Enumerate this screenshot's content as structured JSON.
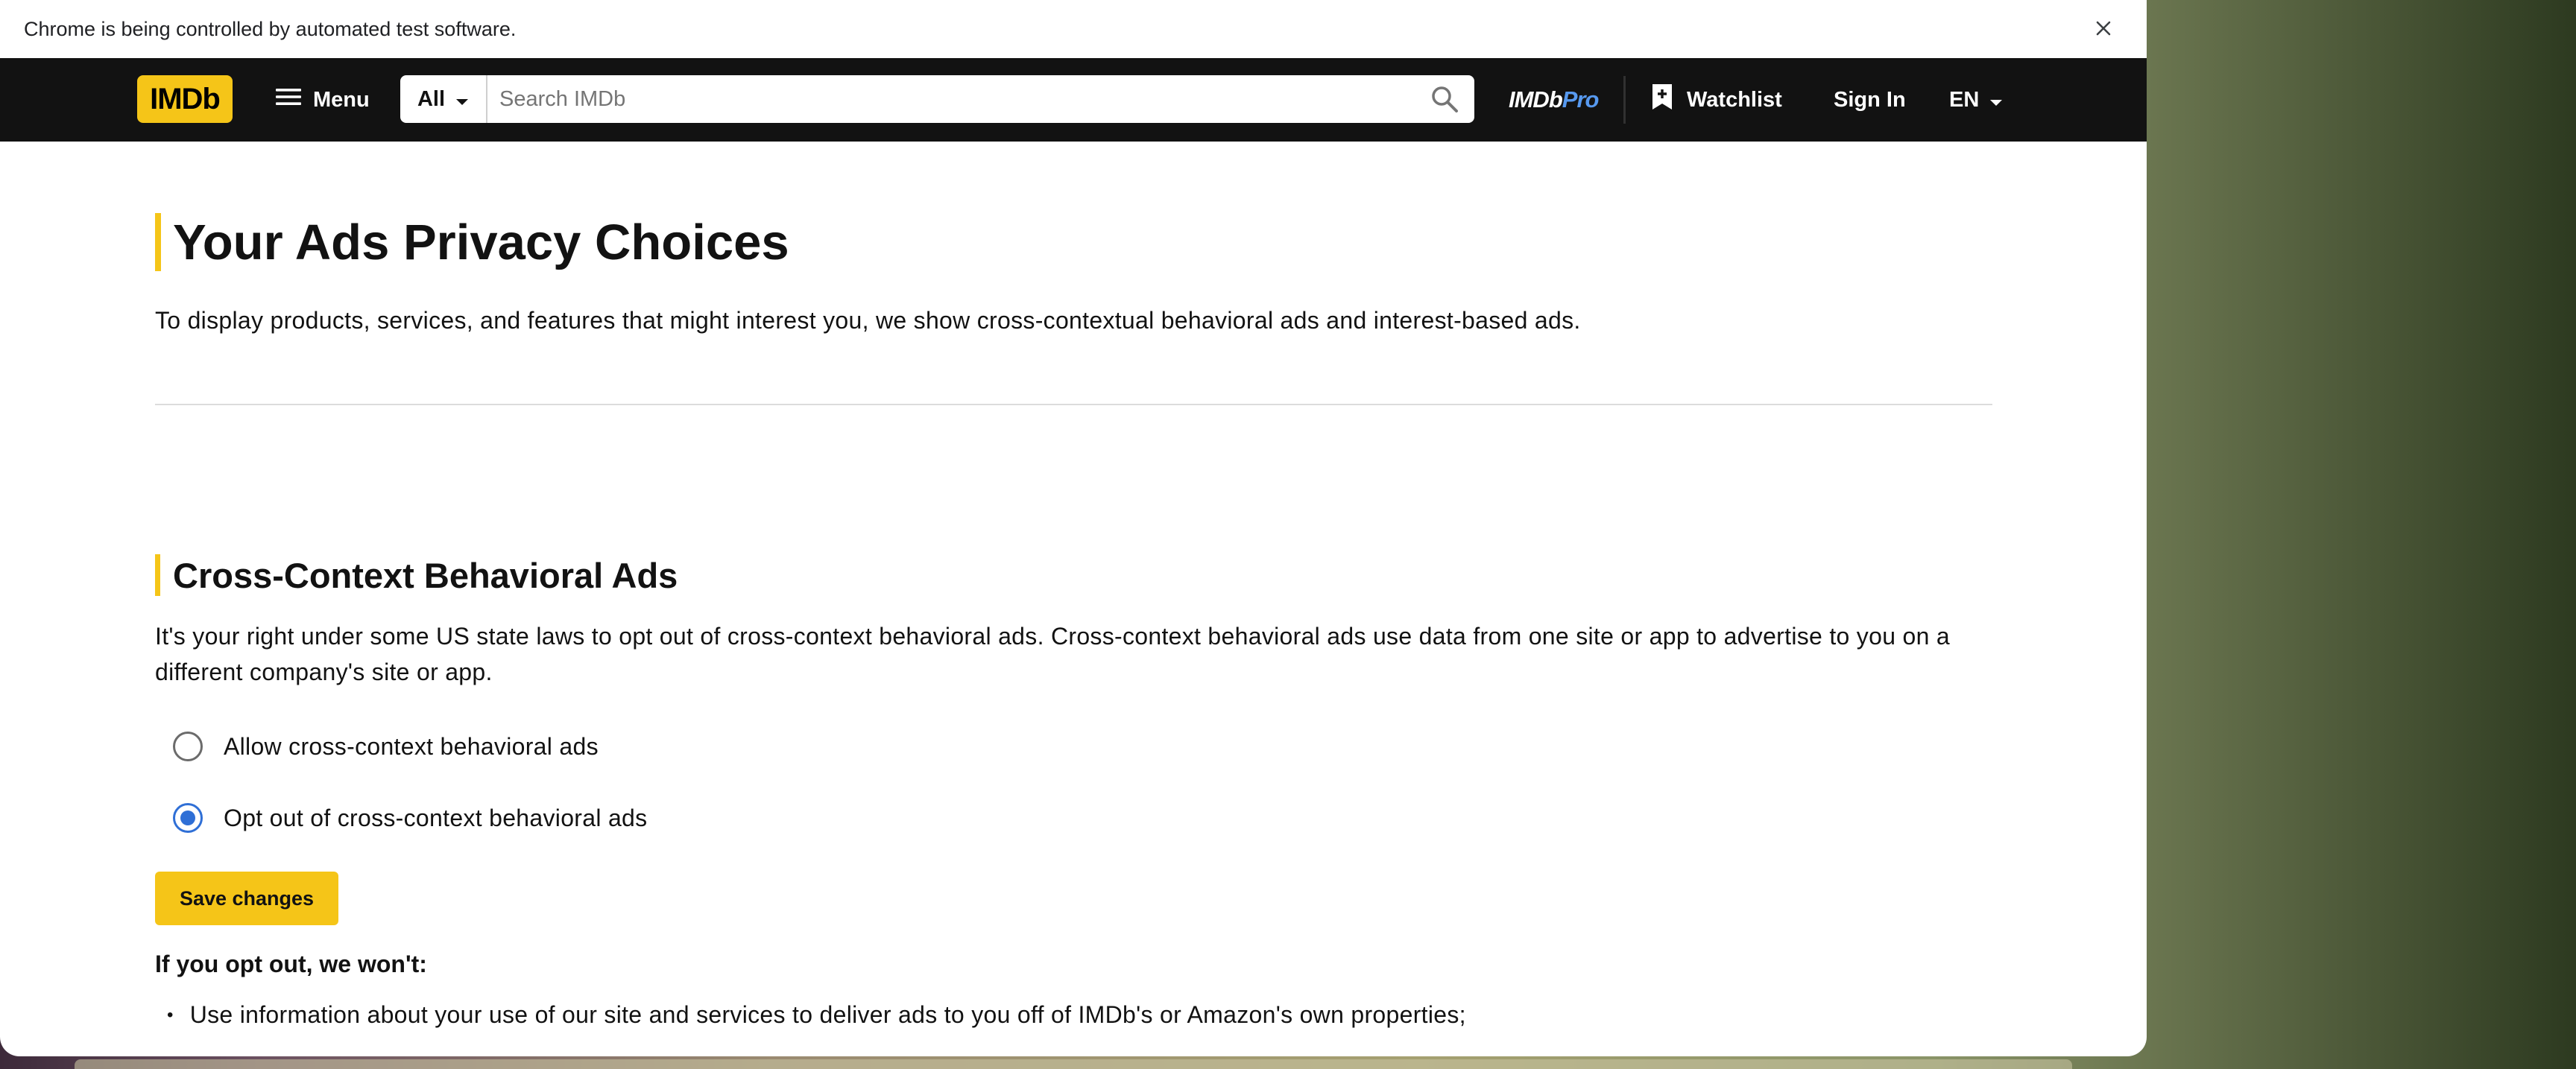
{
  "automation_bar": {
    "message": "Chrome is being controlled by automated test software."
  },
  "nav": {
    "logo": "IMDb",
    "menu_label": "Menu",
    "search_category": "All",
    "search_placeholder": "Search IMDb",
    "search_value": "",
    "imdbpro_part1": "IMDb",
    "imdbpro_part2": "Pro",
    "watchlist_label": "Watchlist",
    "signin_label": "Sign In",
    "language": "EN"
  },
  "page": {
    "title": "Your Ads Privacy Choices",
    "intro": "To display products, services, and features that might interest you, we show cross-contextual behavioral ads and interest-based ads.",
    "section": {
      "title": "Cross-Context Behavioral Ads",
      "paragraph": "It's your right under some US state laws to opt out of cross-context behavioral ads. Cross-context behavioral ads use data from one site or app to advertise to you on a different company's site or app.",
      "options": [
        {
          "label": "Allow cross-context behavioral ads",
          "checked": false
        },
        {
          "label": "Opt out of cross-context behavioral ads",
          "checked": true
        }
      ],
      "save_label": "Save changes",
      "optout_heading": "If you opt out, we won't:",
      "optout_items": [
        "Use information about your use of our site and services to deliver ads to you off of IMDb's or Amazon's own properties;"
      ]
    }
  },
  "colors": {
    "imdb_yellow": "#f5c518",
    "nav_bg": "#121212",
    "radio_selected": "#2f6fd6",
    "pro_blue": "#5799ef"
  },
  "icons": {
    "close": "close-icon",
    "menu": "hamburger-icon",
    "dropdown": "caret-down-icon",
    "search": "search-icon",
    "watchlist": "bookmark-plus-icon"
  }
}
